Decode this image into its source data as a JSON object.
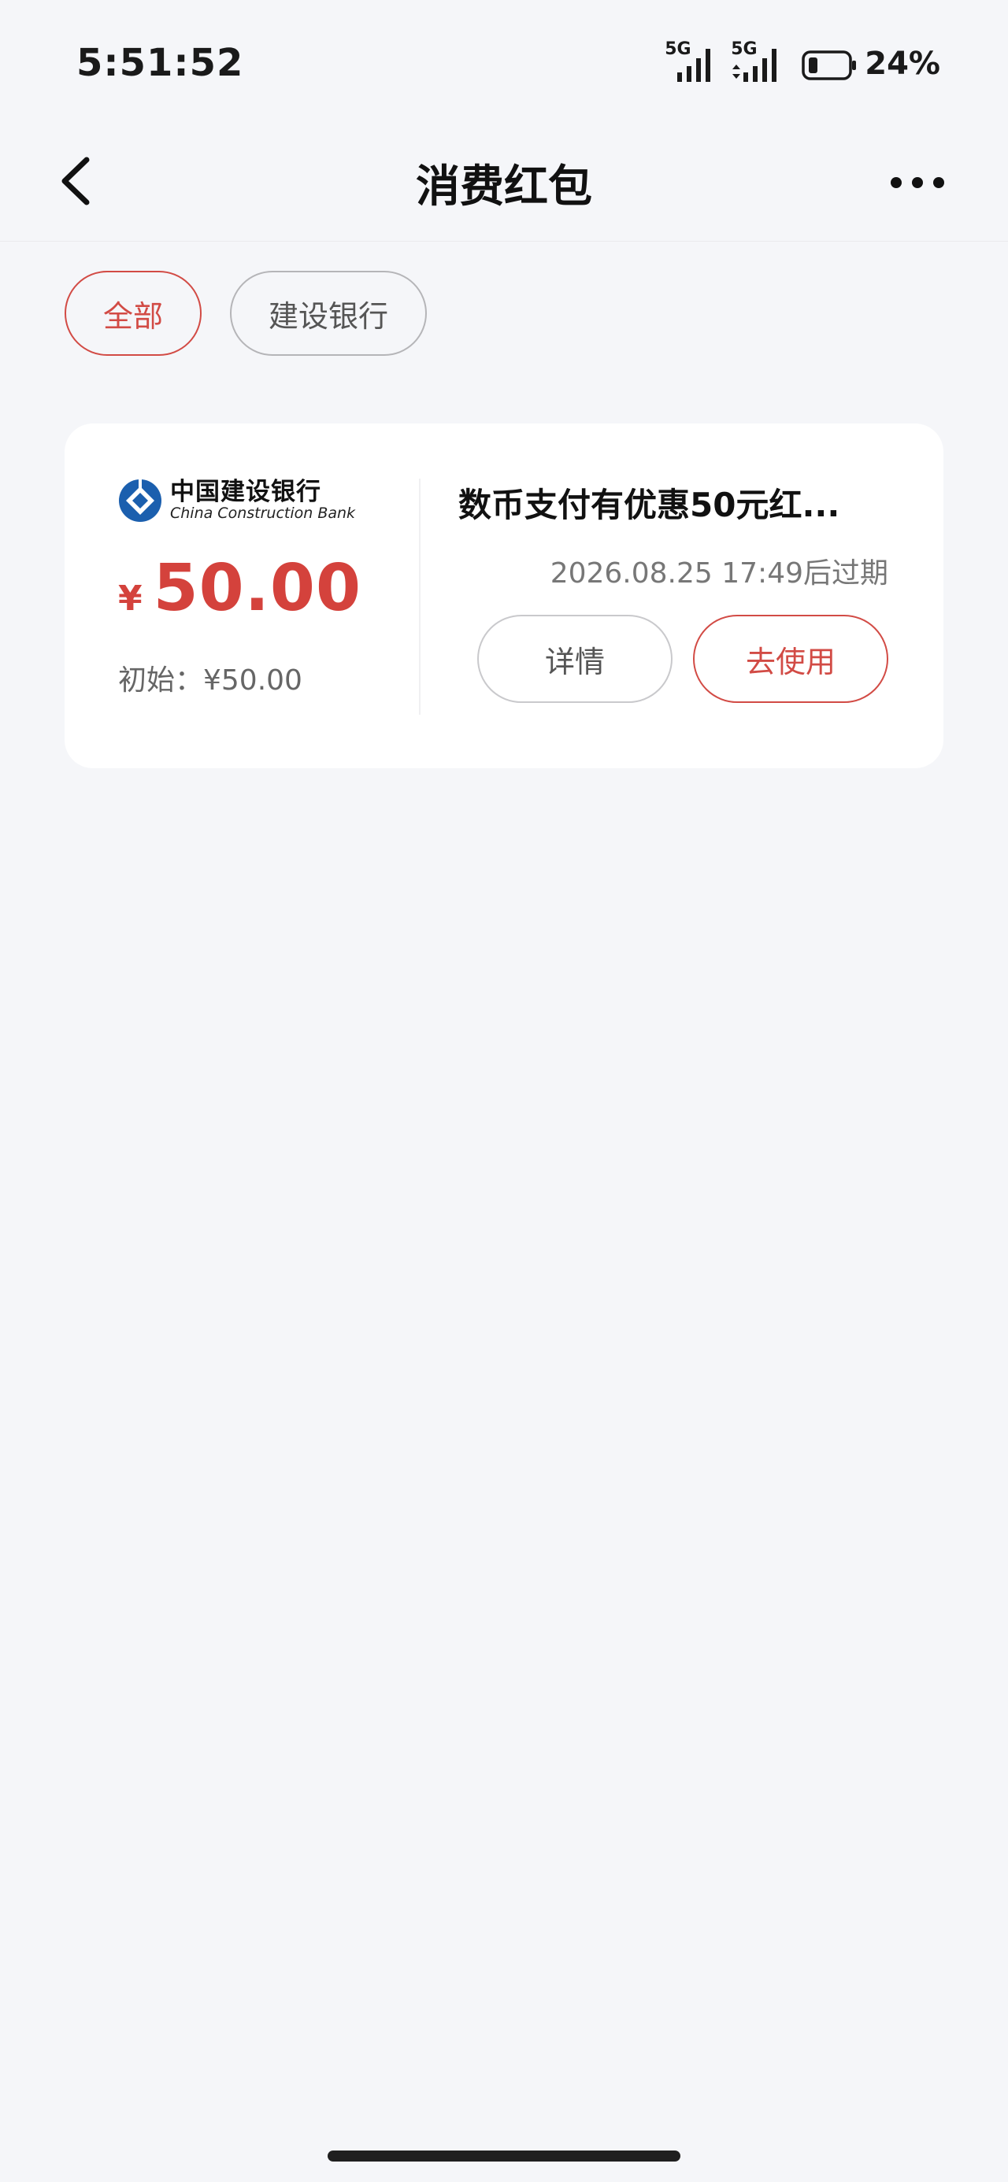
{
  "status_bar": {
    "time": "5:51:52",
    "signal1_label": "5G",
    "signal2_label": "5G",
    "battery_percent": "24%"
  },
  "header": {
    "title": "消费红包"
  },
  "filters": [
    {
      "label": "全部",
      "active": true
    },
    {
      "label": "建设银行",
      "active": false
    }
  ],
  "coupon": {
    "bank_name_cn": "中国建设银行",
    "bank_name_en": "China Construction Bank",
    "currency_symbol": "¥",
    "amount": "50.00",
    "initial": "初始：¥50.00",
    "title": "数币支付有优惠50元红...",
    "expire_text": "2026.08.25 17:49后过期",
    "detail_label": "详情",
    "use_label": "去使用"
  },
  "colors": {
    "accent": "#d24b45",
    "amount": "#d4423c",
    "background": "#f5f6f9",
    "bank_blue": "#1b5fae"
  }
}
